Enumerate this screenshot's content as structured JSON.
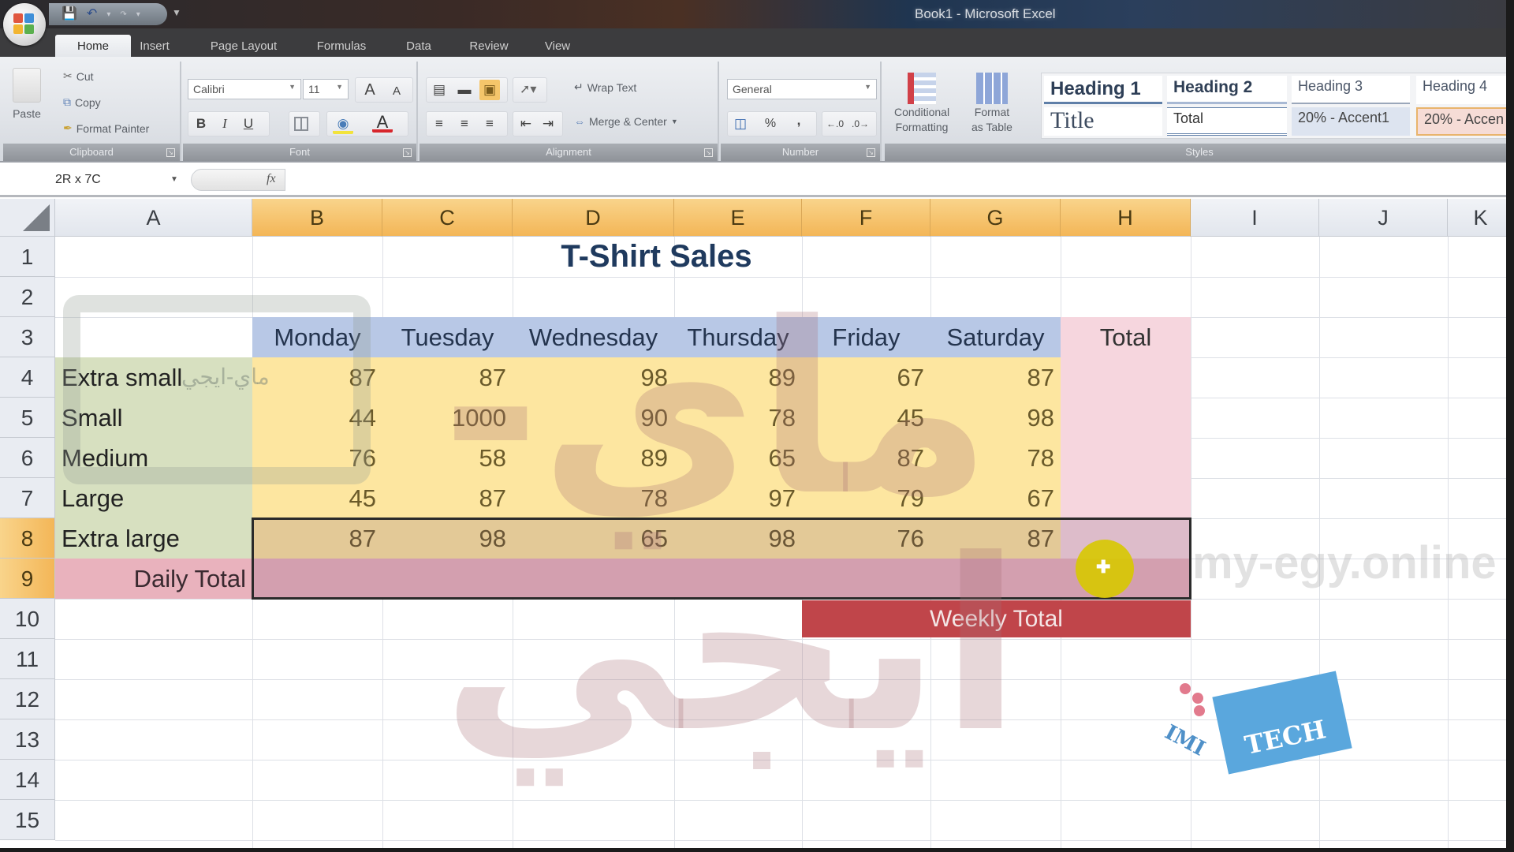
{
  "window": {
    "title": "Book1 - Microsoft Excel"
  },
  "quick_access": {
    "save_icon": "save-icon",
    "undo_icon": "undo-icon",
    "redo_icon": "redo-icon"
  },
  "tabs": [
    {
      "label": "Home",
      "active": true
    },
    {
      "label": "Insert"
    },
    {
      "label": "Page Layout"
    },
    {
      "label": "Formulas"
    },
    {
      "label": "Data"
    },
    {
      "label": "Review"
    },
    {
      "label": "View"
    }
  ],
  "ribbon": {
    "clipboard": {
      "label": "Clipboard",
      "paste": "Paste",
      "cut": "Cut",
      "copy": "Copy",
      "format_painter": "Format Painter"
    },
    "font": {
      "label": "Font",
      "family": "Calibri",
      "size": "11",
      "bold": "B",
      "italic": "I",
      "underline": "U",
      "grow": "A",
      "shrink": "A",
      "font_color": "A"
    },
    "alignment": {
      "label": "Alignment",
      "wrap_text": "Wrap Text",
      "merge_center": "Merge & Center"
    },
    "number": {
      "label": "Number",
      "format": "General",
      "percent": "%",
      "comma": ","
    },
    "styles": {
      "label": "Styles",
      "conditional_formatting": [
        "Conditional",
        "Formatting"
      ],
      "format_as_table": [
        "Format",
        "as Table"
      ],
      "gallery": [
        [
          "Heading 1",
          "Heading 2",
          "Heading 3",
          "Heading 4"
        ],
        [
          "Title",
          "Total",
          "20% - Accent1",
          "20% - Accen"
        ]
      ]
    }
  },
  "formula_bar": {
    "name_box": "2R x 7C",
    "fx": "fx",
    "value": ""
  },
  "columns": [
    "A",
    "B",
    "C",
    "D",
    "E",
    "F",
    "G",
    "H",
    "I",
    "J",
    "K"
  ],
  "selected_columns": [
    "B",
    "C",
    "D",
    "E",
    "F",
    "G",
    "H"
  ],
  "rows": [
    "1",
    "2",
    "3",
    "4",
    "5",
    "6",
    "7",
    "8",
    "9",
    "10",
    "11",
    "12",
    "13",
    "14",
    "15"
  ],
  "selected_rows": [
    "8",
    "9"
  ],
  "sheet": {
    "title": "T-Shirt Sales",
    "days": [
      "Monday",
      "Tuesday",
      "Wednesday",
      "Thursday",
      "Friday",
      "Saturday"
    ],
    "total_header": "Total",
    "sizes": [
      {
        "label": "Extra small",
        "values": [
          87,
          87,
          98,
          89,
          67,
          87
        ]
      },
      {
        "label": "Small",
        "values": [
          44,
          1000,
          90,
          78,
          45,
          98
        ]
      },
      {
        "label": "Medium",
        "values": [
          76,
          58,
          89,
          65,
          87,
          78
        ]
      },
      {
        "label": "Large",
        "values": [
          45,
          87,
          78,
          97,
          79,
          67
        ]
      },
      {
        "label": "Extra large",
        "values": [
          87,
          98,
          65,
          98,
          76,
          87
        ]
      }
    ],
    "daily_total_label": "Daily Total",
    "weekly_total_label": "Weekly Total"
  },
  "colors": {
    "header_fill": "#b8c8e6",
    "data_fill": "#fde6a0",
    "label_fill": "#d7e0c0",
    "total_fill": "#f6d6de",
    "daily_total_fill": "#e9b2bd",
    "weekly_total_fill": "#c0454a",
    "selected_header": "#f6c068"
  },
  "watermarks": {
    "site": "my-egy.online",
    "arabic": "ماي-ايجي",
    "arabic_small": "ماي-ايجي",
    "badge": "TECH",
    "badge_prefix": "IMI"
  }
}
